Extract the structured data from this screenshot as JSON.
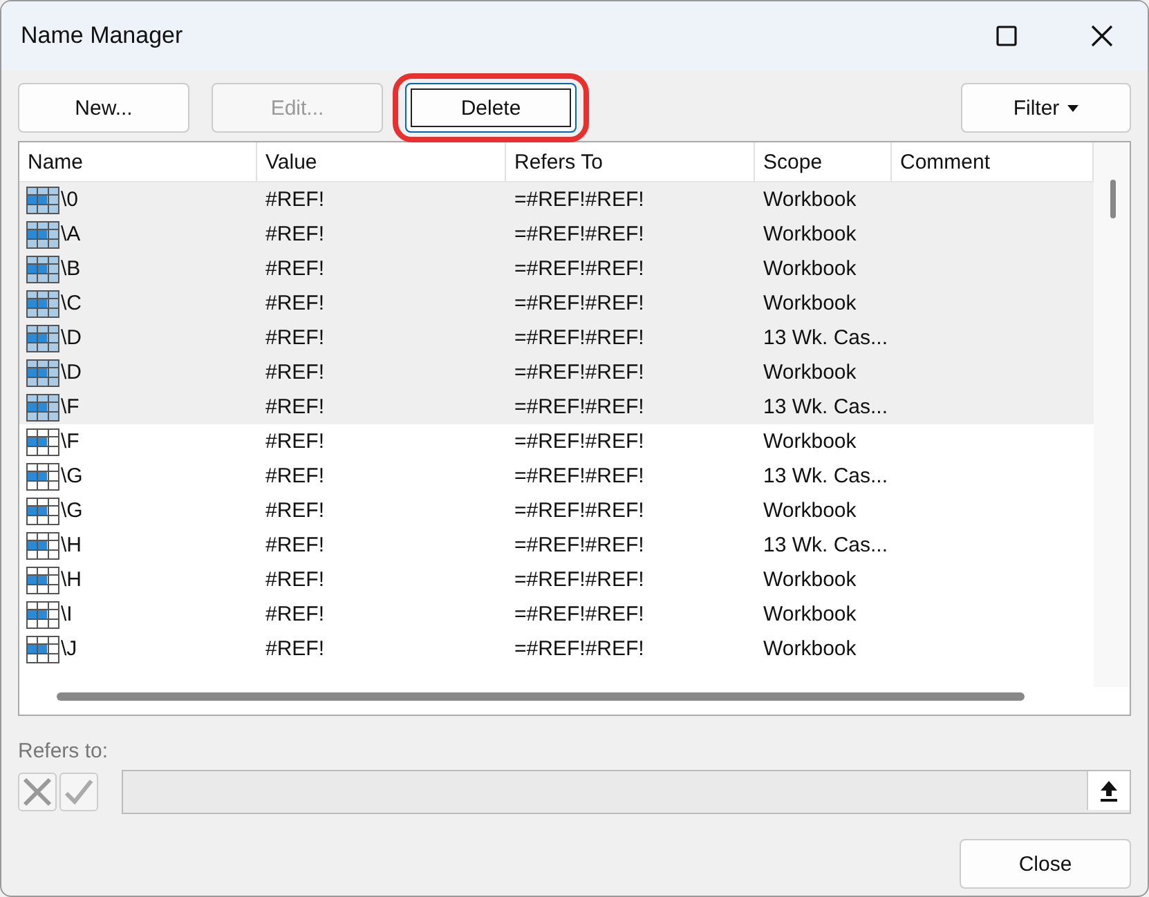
{
  "window": {
    "title": "Name Manager"
  },
  "buttons": [
    {
      "label": "New...",
      "disabled": false,
      "highlighted": false
    },
    {
      "label": "Edit...",
      "disabled": true,
      "highlighted": false
    },
    {
      "label": "Delete",
      "disabled": false,
      "highlighted": true
    }
  ],
  "filter_button": {
    "label": "Filter"
  },
  "table": {
    "columns": [
      "Name",
      "Value",
      "Refers To",
      "Scope",
      "Comment"
    ],
    "rows": [
      {
        "name": "\\0",
        "value": "#REF!",
        "refers_to": "=#REF!#REF!",
        "scope": "Workbook",
        "selected": true
      },
      {
        "name": "\\A",
        "value": "#REF!",
        "refers_to": "=#REF!#REF!",
        "scope": "Workbook",
        "selected": true
      },
      {
        "name": "\\B",
        "value": "#REF!",
        "refers_to": "=#REF!#REF!",
        "scope": "Workbook",
        "selected": true
      },
      {
        "name": "\\C",
        "value": "#REF!",
        "refers_to": "=#REF!#REF!",
        "scope": "Workbook",
        "selected": true
      },
      {
        "name": "\\D",
        "value": "#REF!",
        "refers_to": "=#REF!#REF!",
        "scope": "13 Wk. Cas...",
        "selected": true
      },
      {
        "name": "\\D",
        "value": "#REF!",
        "refers_to": "=#REF!#REF!",
        "scope": "Workbook",
        "selected": true
      },
      {
        "name": "\\F",
        "value": "#REF!",
        "refers_to": "=#REF!#REF!",
        "scope": "13 Wk. Cas...",
        "selected": true
      },
      {
        "name": "\\F",
        "value": "#REF!",
        "refers_to": "=#REF!#REF!",
        "scope": "Workbook",
        "selected": false
      },
      {
        "name": "\\G",
        "value": "#REF!",
        "refers_to": "=#REF!#REF!",
        "scope": "13 Wk. Cas...",
        "selected": false
      },
      {
        "name": "\\G",
        "value": "#REF!",
        "refers_to": "=#REF!#REF!",
        "scope": "Workbook",
        "selected": false
      },
      {
        "name": "\\H",
        "value": "#REF!",
        "refers_to": "=#REF!#REF!",
        "scope": "13 Wk. Cas...",
        "selected": false
      },
      {
        "name": "\\H",
        "value": "#REF!",
        "refers_to": "=#REF!#REF!",
        "scope": "Workbook",
        "selected": false
      },
      {
        "name": "\\I",
        "value": "#REF!",
        "refers_to": "=#REF!#REF!",
        "scope": "Workbook",
        "selected": false
      },
      {
        "name": "\\J",
        "value": "#REF!",
        "refers_to": "=#REF!#REF!",
        "scope": "Workbook",
        "selected": false
      }
    ]
  },
  "refers_to": {
    "label": "Refers to:"
  },
  "close_button": {
    "label": "Close"
  }
}
